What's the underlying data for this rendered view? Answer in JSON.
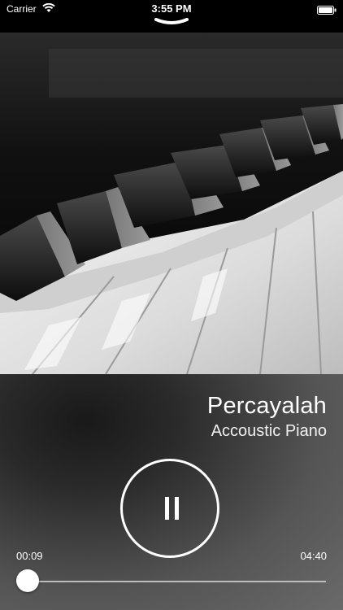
{
  "status_bar": {
    "carrier": "Carrier",
    "time": "3:55 PM"
  },
  "artwork": {
    "icon": "piano-keys-image"
  },
  "track": {
    "title": "Percayalah",
    "artist": "Accoustic Piano"
  },
  "playback": {
    "state": "playing",
    "control_icon": "pause-icon",
    "elapsed": "00:09",
    "duration": "04:40",
    "progress": 0.032
  },
  "colors": {
    "accent": "#ffffff",
    "track": "#bdbdbd"
  }
}
